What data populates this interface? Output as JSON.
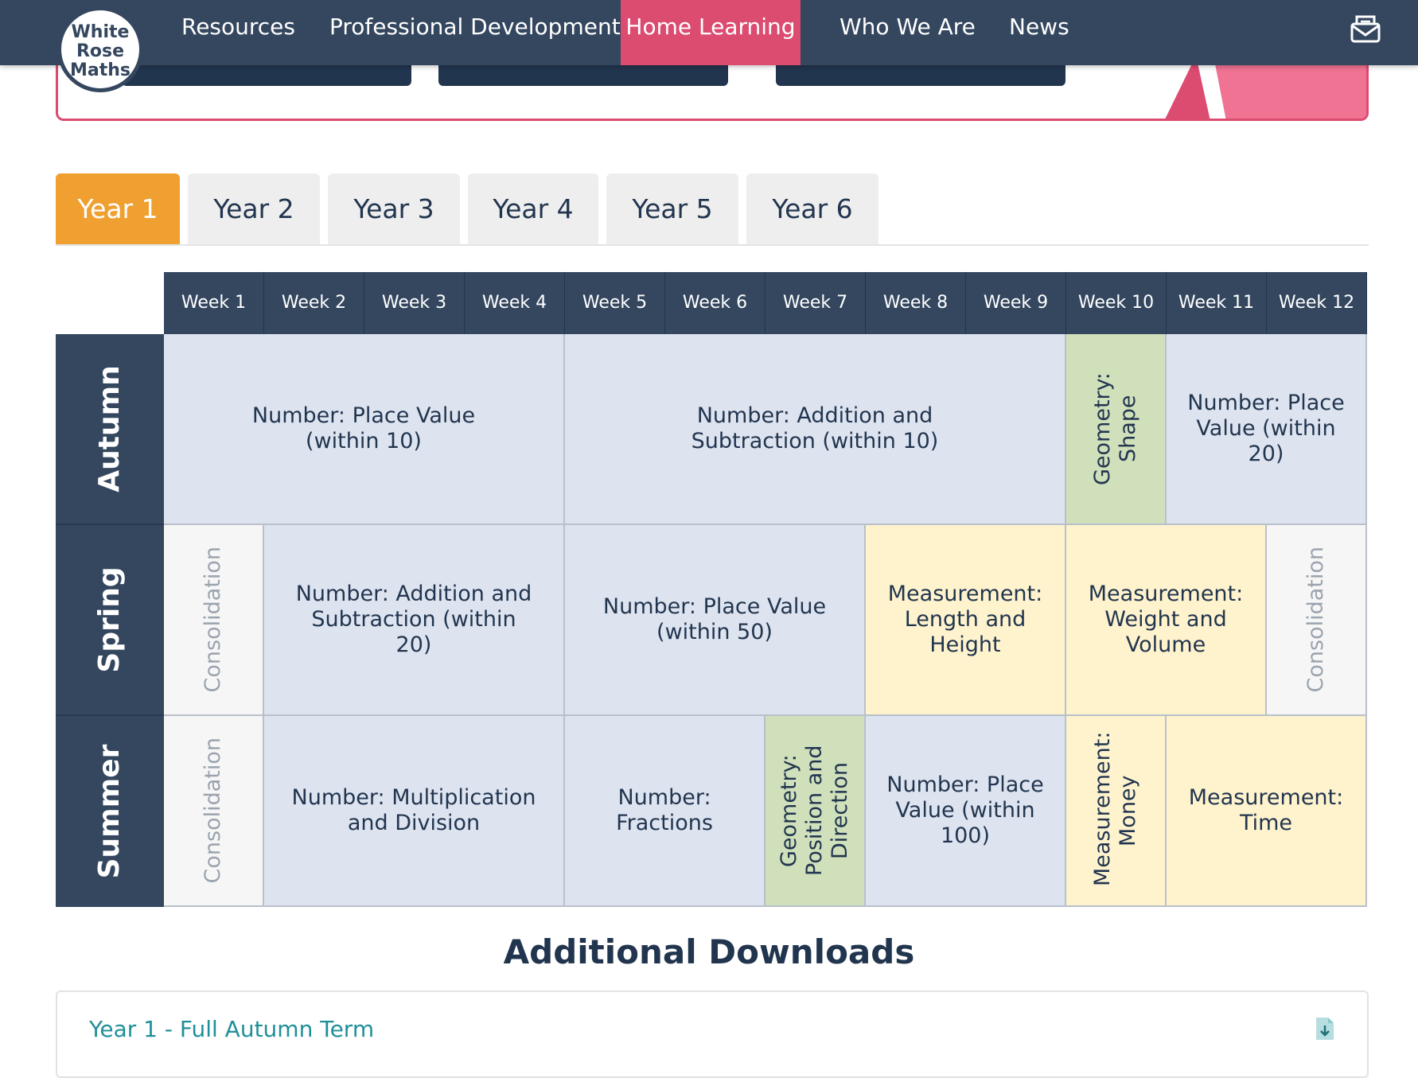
{
  "logo": {
    "lines": [
      "White",
      "Rose",
      "Maths"
    ]
  },
  "nav": {
    "items": [
      {
        "label": "Resources"
      },
      {
        "label": "Professional Development"
      },
      {
        "label": "Home Learning"
      },
      {
        "label": "Who We Are"
      },
      {
        "label": "News"
      }
    ],
    "active": "Home Learning",
    "mail_icon": "mail-icon",
    "colors": {
      "bar": "#34475f",
      "active": "#dc4b70"
    }
  },
  "tabs": {
    "items": [
      "Year 1",
      "Year 2",
      "Year 3",
      "Year 4",
      "Year 5",
      "Year 6"
    ],
    "active": "Year 1",
    "active_color": "#f0a030"
  },
  "scheme": {
    "weeks": [
      "Week 1",
      "Week 2",
      "Week 3",
      "Week 4",
      "Week 5",
      "Week 6",
      "Week 7",
      "Week 8",
      "Week 9",
      "Week 10",
      "Week 11",
      "Week 12"
    ],
    "seasons": [
      "Autumn",
      "Spring",
      "Summer"
    ],
    "autumn": {
      "place_value_10": "Number: Place Value (within 10)",
      "add_sub_10": "Number: Addition and Subtraction (within 10)",
      "geometry_shape": "Geometry: Shape",
      "place_value_20": "Number: Place Value (within 20)"
    },
    "spring": {
      "consolidation_start": "Consolidation",
      "add_sub_20": "Number: Addition and Subtraction (within 20)",
      "place_value_50": "Number: Place Value (within 50)",
      "length_height": "Measurement: Length and Height",
      "weight_volume": "Measurement: Weight and Volume",
      "consolidation_end": "Consolidation"
    },
    "summer": {
      "consolidation": "Consolidation",
      "mult_div": "Number: Multiplication and Division",
      "fractions": "Number: Fractions",
      "position_direction": "Geometry: Position and Direction",
      "place_value_100": "Number: Place Value (within 100)",
      "money": "Measurement: Money",
      "time": "Measurement: Time"
    },
    "colors": {
      "number": "#dde4f0",
      "geometry": "#cfe0bb",
      "measurement": "#fef3cd",
      "consolidation": "#f6f6f6"
    }
  },
  "downloads": {
    "title": "Additional Downloads",
    "items": [
      {
        "label": "Year 1 - Full Autumn Term",
        "icon": "download-file-icon"
      }
    ]
  }
}
